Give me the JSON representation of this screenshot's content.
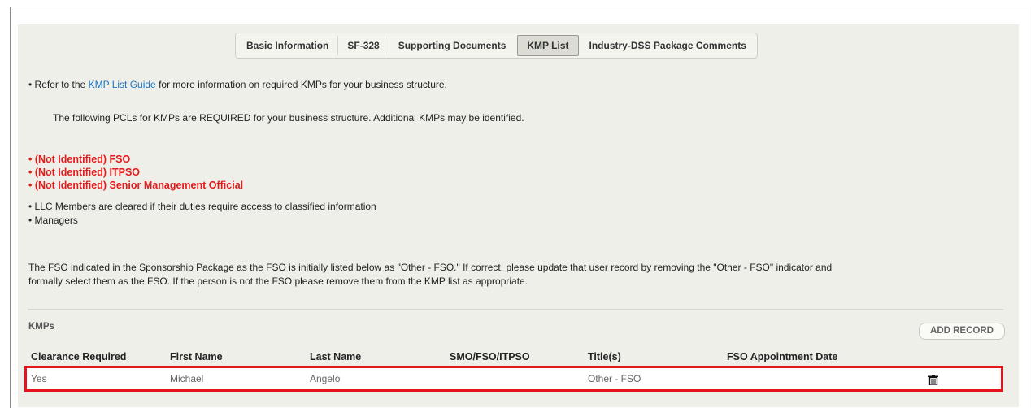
{
  "tabs": [
    {
      "label": "Basic Information",
      "active": false
    },
    {
      "label": "SF-328",
      "active": false
    },
    {
      "label": "Supporting Documents",
      "active": false
    },
    {
      "label": "KMP List",
      "active": true
    },
    {
      "label": "Industry-DSS Package Comments",
      "active": false
    }
  ],
  "guide": {
    "prefix": "• Refer to the ",
    "link": "KMP List Guide",
    "suffix": " for more information on required KMPs for your business structure."
  },
  "required_note": "The following PCLs for KMPs are REQUIRED for your business structure. Additional KMPs may be identified.",
  "required_items": [
    "• (Not Identified) FSO",
    "• (Not Identified) ITPSO",
    "• (Not Identified) Senior Management Official"
  ],
  "other_items": [
    "• LLC Members are cleared if their duties require access to classified information",
    "• Managers"
  ],
  "fso_note_line1": "The FSO indicated in the Sponsorship Package as the FSO is initially listed below as \"Other - FSO.\" If correct, please update that user record by removing the \"Other - FSO\" indicator and",
  "fso_note_line2": "formally select them as the FSO. If the person is not the FSO please remove them from the KMP list as appropriate.",
  "kmps": {
    "section_label": "KMPs",
    "add_button": "ADD RECORD",
    "columns": [
      "Clearance Required",
      "First Name",
      "Last Name",
      "SMO/FSO/ITPSO",
      "Title(s)",
      "FSO Appointment Date"
    ],
    "rows": [
      {
        "clearance": "Yes",
        "first": "Michael",
        "last": "Angelo",
        "smo": "",
        "titles": "Other - FSO",
        "fso_date": "",
        "action_icon": "trash-icon"
      }
    ]
  },
  "colors": {
    "link": "#1a72c4",
    "required": "#e41b1b",
    "highlight": "#e5141c"
  }
}
